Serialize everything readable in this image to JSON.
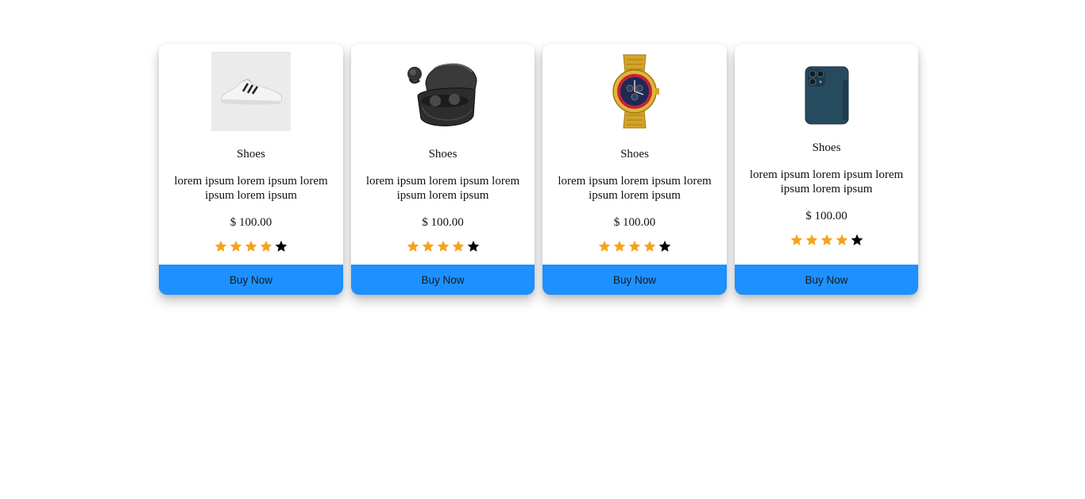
{
  "products": [
    {
      "name": "Shoes",
      "description": "lorem ipsum lorem ipsum lorem ipsum lorem ipsum",
      "price": "$ 100.00",
      "rating": 4,
      "rating_max": 5,
      "image": "sneaker-image",
      "button_label": "Buy Now"
    },
    {
      "name": "Shoes",
      "description": "lorem ipsum lorem ipsum lorem ipsum lorem ipsum",
      "price": "$ 100.00",
      "rating": 4,
      "rating_max": 5,
      "image": "earbuds-image",
      "button_label": "Buy Now"
    },
    {
      "name": "Shoes",
      "description": "lorem ipsum lorem ipsum lorem ipsum lorem ipsum",
      "price": "$ 100.00",
      "rating": 4,
      "rating_max": 5,
      "image": "watch-image",
      "button_label": "Buy Now"
    },
    {
      "name": "Shoes",
      "description": "lorem ipsum lorem ipsum lorem ipsum lorem ipsum",
      "price": "$ 100.00",
      "rating": 4,
      "rating_max": 5,
      "image": "phone-image",
      "button_label": "Buy Now"
    }
  ],
  "colors": {
    "button": "#1e90ff",
    "star_filled": "#f7a21b",
    "star_empty": "#000000"
  }
}
